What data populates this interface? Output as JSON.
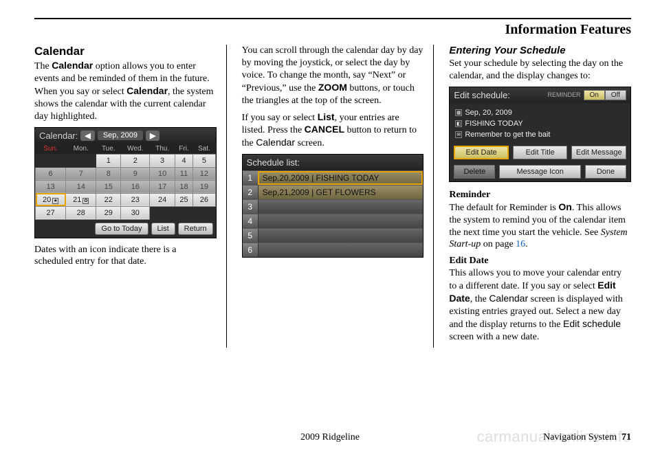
{
  "header": {
    "title": "Information Features"
  },
  "col1": {
    "h": "Calendar",
    "p1a": "The ",
    "p1b": "Calendar",
    "p1c": " option allows you to enter events and be reminded of them in the future. When you say or select ",
    "p1d": "Calendar",
    "p1e": ", the system shows the calendar with the current calendar day highlighted.",
    "p2": "Dates with an icon indicate there is a scheduled entry for that date."
  },
  "calendar": {
    "label": "Calendar:",
    "prev": "◀",
    "month": "Sep, 2009",
    "next": "▶",
    "days": [
      "Sun.",
      "Mon.",
      "Tue.",
      "Wed.",
      "Thu.",
      "Fri.",
      "Sat."
    ],
    "rows": [
      [
        "",
        "",
        "1",
        "2",
        "3",
        "4",
        "5"
      ],
      [
        "6",
        "7",
        "8",
        "9",
        "10",
        "11",
        "12"
      ],
      [
        "13",
        "14",
        "15",
        "16",
        "17",
        "18",
        "19"
      ],
      [
        "20",
        "21",
        "22",
        "23",
        "24",
        "25",
        "26"
      ],
      [
        "27",
        "28",
        "29",
        "30",
        "",
        "",
        ""
      ]
    ],
    "btn_today": "Go to Today",
    "btn_list": "List",
    "btn_return": "Return"
  },
  "col2": {
    "p1a": "You can scroll through the calendar day by day by moving the joystick, or select the day by voice. To change the month, say “Next” or “Previous,” use the ",
    "p1b": "ZOOM",
    "p1c": " buttons, or touch the triangles at the top of the screen.",
    "p2a": "If you say or select ",
    "p2b": "List",
    "p2c": ", your entries are listed. Press the ",
    "p2d": "CANCEL",
    "p2e": " button to return to the ",
    "p2f": "Calendar",
    "p2g": " screen."
  },
  "schedule_list": {
    "title": "Schedule list:",
    "rows": [
      {
        "n": "1",
        "t": "Sep,20,2009 | FISHING TODAY"
      },
      {
        "n": "2",
        "t": "Sep,21,2009 | GET FLOWERS"
      },
      {
        "n": "3",
        "t": ""
      },
      {
        "n": "4",
        "t": ""
      },
      {
        "n": "5",
        "t": ""
      },
      {
        "n": "6",
        "t": ""
      }
    ]
  },
  "col3": {
    "h": "Entering Your Schedule",
    "p1": "Set your schedule by selecting the day on the calendar, and the display changes to:",
    "rem_h": "Reminder",
    "rem_a": "The default for Reminder is ",
    "rem_b": "On",
    "rem_c": ". This allows the system to remind you of the calendar item the next time you start the vehicle. See ",
    "rem_d": "System Start-up",
    "rem_e": " on page ",
    "rem_f": "16",
    "rem_g": ".",
    "ed_h": "Edit Date",
    "ed_a": "This allows you to move your calendar entry to a different date. If you say or select ",
    "ed_b": "Edit Date",
    "ed_c": ", the ",
    "ed_d": "Calendar",
    "ed_e": " screen is displayed with existing entries grayed out. Select a new day and the display returns to the ",
    "ed_f": "Edit schedule",
    "ed_g": " screen with a new date."
  },
  "edit_schedule": {
    "title": "Edit schedule:",
    "rem_label": "REMINDER",
    "on": "On",
    "off": "Off",
    "line1": "Sep, 20, 2009",
    "line2": "FISHING TODAY",
    "line3": "Remember to get the bait",
    "btn_edit_date": "Edit Date",
    "btn_edit_title": "Edit Title",
    "btn_edit_msg": "Edit Message",
    "btn_delete": "Delete",
    "btn_msg_icon": "Message Icon",
    "btn_done": "Done"
  },
  "footer": {
    "model": "2009  Ridgeline",
    "nav": "Navigation System",
    "page": "71",
    "watermark": "carmanualsonline.info"
  }
}
